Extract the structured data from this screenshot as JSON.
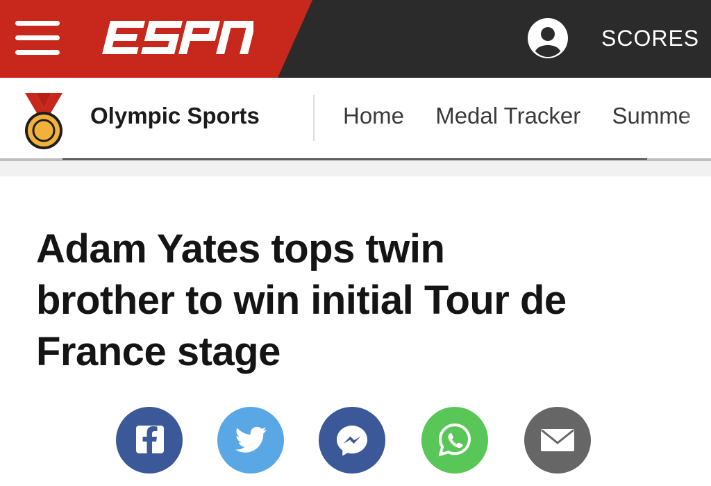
{
  "header": {
    "brand": "ESPN",
    "scores_label": "SCORES",
    "brand_red": "#c8281c",
    "bar_color": "#2b2b2b",
    "menu_icon": "hamburger-menu-icon",
    "profile_icon": "user-profile-icon"
  },
  "subnav": {
    "section_title": "Olympic Sports",
    "section_icon": "gold-medal-icon",
    "tabs": [
      "Home",
      "Medal Tracker",
      "Summe"
    ]
  },
  "article": {
    "headline_lines": [
      "Adam Yates tops twin",
      "brother to win initial Tour de",
      "France stage"
    ]
  },
  "share": {
    "buttons": [
      {
        "icon": "facebook-icon",
        "color": "#3b5998"
      },
      {
        "icon": "twitter-icon",
        "color": "#5aa7e6"
      },
      {
        "icon": "messenger-icon",
        "color": "#3b5998"
      },
      {
        "icon": "whatsapp-icon",
        "color": "#59c757"
      },
      {
        "icon": "email-icon",
        "color": "#666666"
      }
    ]
  }
}
